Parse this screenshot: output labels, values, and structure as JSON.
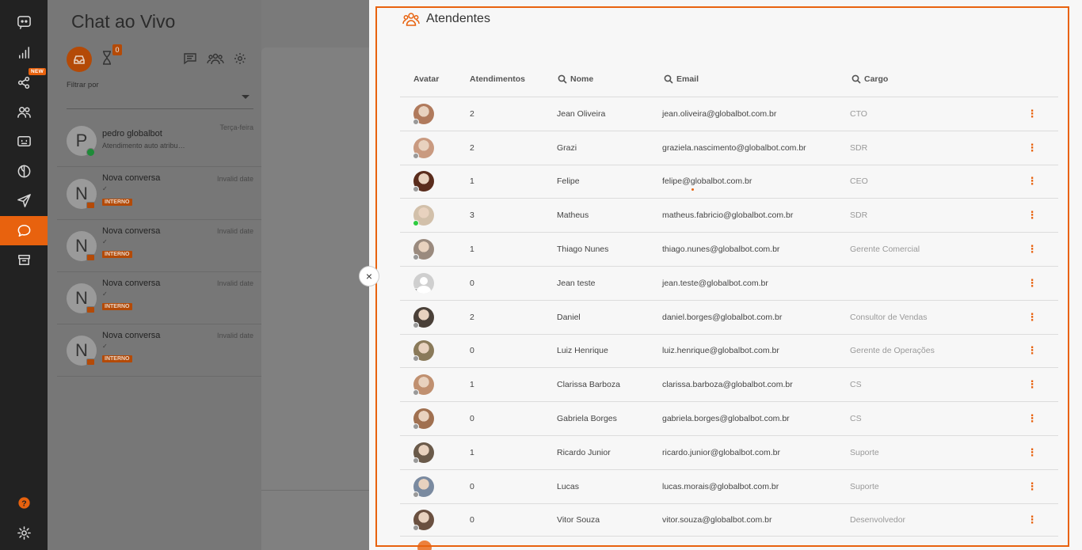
{
  "rail": {
    "new_badge": "NEW",
    "items": [
      {
        "icon": "bot-logo-icon",
        "active": false
      },
      {
        "icon": "bar-chart-icon",
        "active": false
      },
      {
        "icon": "share-nodes-icon",
        "active": false
      },
      {
        "icon": "users-icon",
        "active": false
      },
      {
        "icon": "bot-face-icon",
        "active": false
      },
      {
        "icon": "circle-split-icon",
        "active": false
      },
      {
        "icon": "send-icon",
        "active": false
      },
      {
        "icon": "chat-bubble-icon",
        "active": true
      },
      {
        "icon": "archive-icon",
        "active": false
      },
      {
        "icon": "help-icon",
        "active": false
      },
      {
        "icon": "gear-icon",
        "active": false
      }
    ]
  },
  "chat_panel": {
    "title": "Chat ao Vivo",
    "queue_count": "0",
    "filter_label": "Filtrar por",
    "conversations": [
      {
        "initial": "P",
        "name": "pedro globalbot",
        "date": "Terça-feira",
        "preview": "Atendimento auto atribu…",
        "tag": "",
        "channel": "whatsapp"
      },
      {
        "initial": "N",
        "name": "Nova conversa",
        "date": "Invalid date",
        "preview": "",
        "tag": "INTERNO",
        "channel": "internal"
      },
      {
        "initial": "N",
        "name": "Nova conversa",
        "date": "Invalid date",
        "preview": "",
        "tag": "INTERNO",
        "channel": "internal"
      },
      {
        "initial": "N",
        "name": "Nova conversa",
        "date": "Invalid date",
        "preview": "",
        "tag": "INTERNO",
        "channel": "internal"
      },
      {
        "initial": "N",
        "name": "Nova conversa",
        "date": "Invalid date",
        "preview": "",
        "tag": "INTERNO",
        "channel": "internal"
      }
    ]
  },
  "drawer": {
    "title": "Atendentes",
    "close_glyph": "×",
    "columns": {
      "avatar": "Avatar",
      "atendimentos": "Atendimentos",
      "nome": "Nome",
      "email": "Email",
      "cargo": "Cargo"
    },
    "agents": [
      {
        "atendimentos": "2",
        "nome": "Jean Oliveira",
        "email": "jean.oliveira@globalbot.com.br",
        "cargo": "CTO",
        "online": false,
        "avatar_color": "#b07a5c"
      },
      {
        "atendimentos": "2",
        "nome": "Grazi",
        "email": "graziela.nascimento@globalbot.com.br",
        "cargo": "SDR",
        "online": false,
        "avatar_color": "#c99a80"
      },
      {
        "atendimentos": "1",
        "nome": "Felipe",
        "email": "felipe@globalbot.com.br",
        "cargo": "CEO",
        "online": false,
        "avatar_color": "#5a2c1c"
      },
      {
        "atendimentos": "3",
        "nome": "Matheus",
        "email": "matheus.fabricio@globalbot.com.br",
        "cargo": "SDR",
        "online": true,
        "avatar_color": "#d2c0aa"
      },
      {
        "atendimentos": "1",
        "nome": "Thiago Nunes",
        "email": "thiago.nunes@globalbot.com.br",
        "cargo": "Gerente Comercial",
        "online": false,
        "avatar_color": "#9a8a7e"
      },
      {
        "atendimentos": "0",
        "nome": "Jean teste",
        "email": "jean.teste@globalbot.com.br",
        "cargo": "",
        "online": false,
        "avatar_color": ""
      },
      {
        "atendimentos": "2",
        "nome": "Daniel",
        "email": "daniel.borges@globalbot.com.br",
        "cargo": "Consultor de Vendas",
        "online": false,
        "avatar_color": "#4a4038"
      },
      {
        "atendimentos": "0",
        "nome": "Luiz Henrique",
        "email": "luiz.henrique@globalbot.com.br",
        "cargo": "Gerente de Operações",
        "online": false,
        "avatar_color": "#8a7a5a"
      },
      {
        "atendimentos": "1",
        "nome": "Clarissa Barboza",
        "email": "clarissa.barboza@globalbot.com.br",
        "cargo": "CS",
        "online": false,
        "avatar_color": "#c09070"
      },
      {
        "atendimentos": "0",
        "nome": "Gabriela Borges",
        "email": "gabriela.borges@globalbot.com.br",
        "cargo": "CS",
        "online": false,
        "avatar_color": "#a07050"
      },
      {
        "atendimentos": "1",
        "nome": "Ricardo Junior",
        "email": "ricardo.junior@globalbot.com.br",
        "cargo": "Suporte",
        "online": false,
        "avatar_color": "#6a5a4a"
      },
      {
        "atendimentos": "0",
        "nome": "Lucas",
        "email": "lucas.morais@globalbot.com.br",
        "cargo": "Suporte",
        "online": false,
        "avatar_color": "#7a8aa0"
      },
      {
        "atendimentos": "0",
        "nome": "Vitor Souza",
        "email": "vitor.souza@globalbot.com.br",
        "cargo": "Desenvolvedor",
        "online": false,
        "avatar_color": "#6a5040"
      }
    ]
  },
  "colors": {
    "accent": "#e8620e",
    "online": "#2ecc40",
    "offline": "#999999"
  }
}
